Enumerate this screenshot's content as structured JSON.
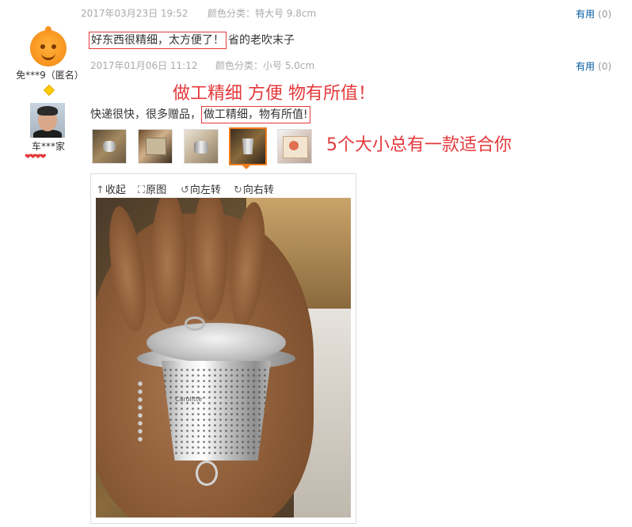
{
  "reviews": [
    {
      "date": "2017年03月23日 19:52",
      "spec": "颜色分类：特大号 9.8cm",
      "useful_label": "有用",
      "useful_count": "(0)",
      "user": "免***9（匿名）",
      "comment_boxed": "好东西很精细，太方便了！",
      "comment_rest": "省的老吹末子"
    },
    {
      "date": "2017年01月06日 11:12",
      "spec": "颜色分类：小号 5.0cm",
      "useful_label": "有用",
      "useful_count": "(0)",
      "user": "车***家",
      "comment_plain": "快递很快，很多赠品，",
      "comment_boxed": "做工精细，物有所值!"
    }
  ],
  "annotations": {
    "headline": "做工精细  方便  物有所值！",
    "sizes_note": "5个大小总有一款适合你"
  },
  "viewer": {
    "collapse": "收起",
    "original": "原图",
    "rotate_left": "向左转",
    "rotate_right": "向右转",
    "stamp_text": "Carolitte"
  },
  "thumbnails": [
    {
      "name": "thumb-1",
      "selected": false
    },
    {
      "name": "thumb-2",
      "selected": false
    },
    {
      "name": "thumb-3",
      "selected": false
    },
    {
      "name": "thumb-4",
      "selected": true
    },
    {
      "name": "thumb-5",
      "selected": false
    }
  ],
  "icons": {
    "collapse": "arrow-up-icon",
    "original": "expand-icon",
    "rotate_left": "rotate-left-icon",
    "rotate_right": "rotate-right-icon"
  },
  "colors": {
    "accent_red": "#e4393c",
    "link_blue": "#005aa0",
    "selected_orange": "#f07d1e"
  }
}
